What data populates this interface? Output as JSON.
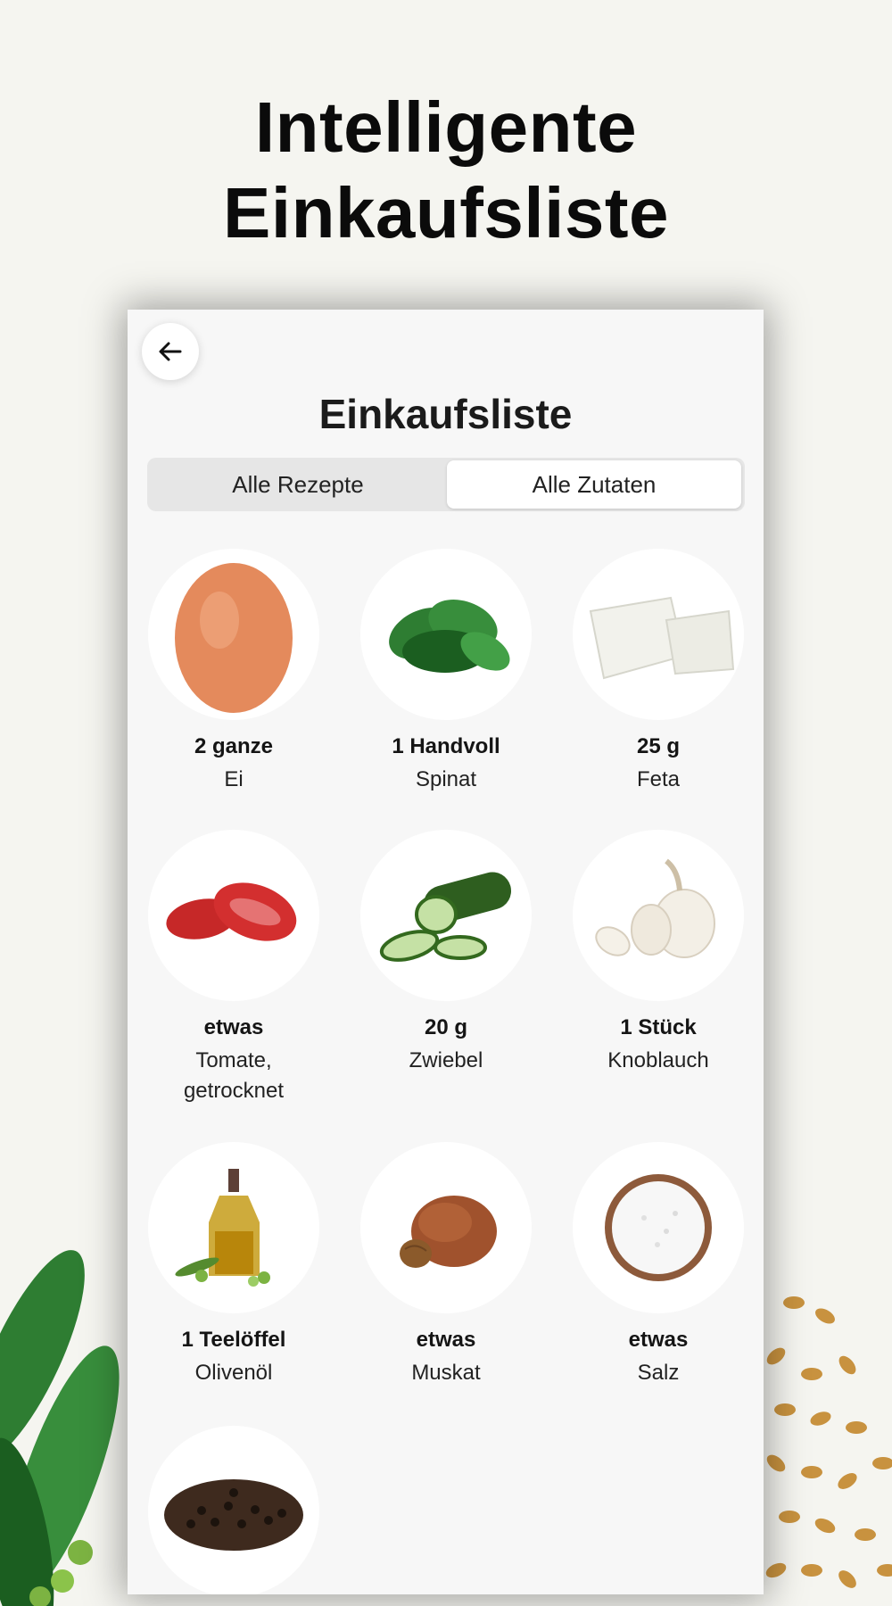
{
  "headline": {
    "line1": "Intelligente",
    "line2": "Einkaufsliste"
  },
  "screen": {
    "title": "Einkaufsliste",
    "tabs": [
      {
        "label": "Alle Rezepte",
        "selected": false
      },
      {
        "label": "Alle Zutaten",
        "selected": true
      }
    ]
  },
  "ingredients": [
    {
      "qty": "2 ganze",
      "name": "Ei",
      "icon": "egg-icon"
    },
    {
      "qty": "1 Handvoll",
      "name": "Spinat",
      "icon": "spinach-icon"
    },
    {
      "qty": "25 g",
      "name": "Feta",
      "icon": "feta-icon"
    },
    {
      "qty": "etwas",
      "name": "Tomate, getrocknet",
      "icon": "dried-tomato-icon"
    },
    {
      "qty": "20 g",
      "name": "Zwiebel",
      "icon": "zucchini-icon"
    },
    {
      "qty": "1 Stück",
      "name": "Knoblauch",
      "icon": "garlic-icon"
    },
    {
      "qty": "1 Teelöffel",
      "name": "Olivenöl",
      "icon": "olive-oil-icon"
    },
    {
      "qty": "etwas",
      "name": "Muskat",
      "icon": "nutmeg-icon"
    },
    {
      "qty": "etwas",
      "name": "Salz",
      "icon": "salt-icon"
    },
    {
      "qty": "",
      "name": "",
      "icon": "pepper-icon"
    }
  ]
}
